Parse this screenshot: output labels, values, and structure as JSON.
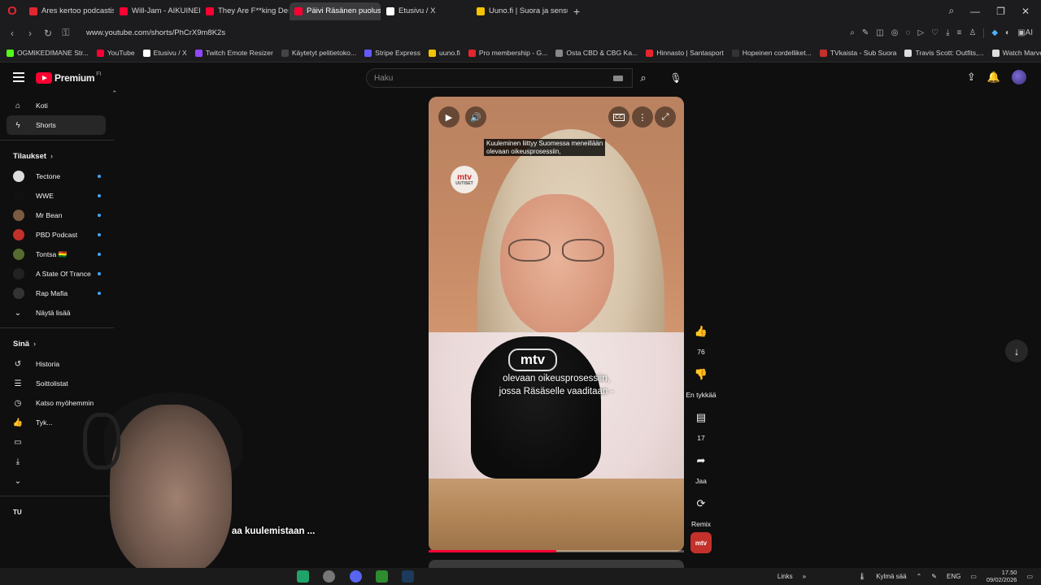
{
  "browser": {
    "tabs": [
      {
        "label": "Ares kertoo podcastissa v",
        "favicon_color": "#e3262f",
        "active": false
      },
      {
        "label": "Will-Jam - AIKUINEN - Yo",
        "favicon_color": "#ff0033",
        "active": false
      },
      {
        "label": "They Are F**king Desperat",
        "favicon_color": "#ff0033",
        "active": false
      },
      {
        "label": "Päivi Räsänen puolustaa k",
        "favicon_color": "#ff0033",
        "active": true
      },
      {
        "label": "Etusivu / X",
        "favicon_color": "#ffffff",
        "active": false
      },
      {
        "label": "Uuno.fi | Suora ja sensuroi",
        "favicon_color": "#f5c400",
        "active": false
      }
    ],
    "url": "www.youtube.com/shorts/PhCrX9m8K2s",
    "bookmarks": [
      {
        "label": "OGMIKEDIMANE Str...",
        "color": "#53fc18"
      },
      {
        "label": "YouTube",
        "color": "#ff0033"
      },
      {
        "label": "Etusivu / X",
        "color": "#ffffff"
      },
      {
        "label": "Twitch Emote Resizer",
        "color": "#9147ff"
      },
      {
        "label": "Käytetyt pelitietoko...",
        "color": "#444444"
      },
      {
        "label": "Stripe Express",
        "color": "#635bff"
      },
      {
        "label": "uuno.fi",
        "color": "#f5c400"
      },
      {
        "label": "Pro membership - G...",
        "color": "#e3262f"
      },
      {
        "label": "Osta CBD & CBG Ka...",
        "color": "#888888"
      },
      {
        "label": "Hinnasto | Santasport",
        "color": "#e3262f"
      },
      {
        "label": "Hopeinen cordelliket...",
        "color": "#333333"
      },
      {
        "label": "TVkaista - Sub Suora",
        "color": "#c4302b"
      },
      {
        "label": "Travis Scott: Outfits,...",
        "color": "#dddddd"
      },
      {
        "label": "Watch Marvel's Luk...",
        "color": "#dddddd"
      }
    ]
  },
  "youtube": {
    "logo_text": "Premium",
    "region": "FI",
    "search_placeholder": "Haku",
    "sidebar": {
      "main": [
        {
          "label": "Koti",
          "icon": "home-icon",
          "selected": false
        },
        {
          "label": "Shorts",
          "icon": "shorts-icon",
          "selected": true
        }
      ],
      "subscriptions_title": "Tilaukset",
      "subscriptions": [
        {
          "label": "Tectone",
          "color": "#dddddd"
        },
        {
          "label": "WWE",
          "color": "#111111"
        },
        {
          "label": "Mr Bean",
          "color": "#7a5a40"
        },
        {
          "label": "PBD Podcast",
          "color": "#c4302b"
        },
        {
          "label": "Tontsa 🇧🇴",
          "color": "#556b2f"
        },
        {
          "label": "A State Of Trance",
          "color": "#222222"
        },
        {
          "label": "Rap Mafia",
          "color": "#333333"
        }
      ],
      "show_more": "Näytä lisää",
      "you_title": "Sinä",
      "you_items": [
        {
          "label": "Historia",
          "icon": "history-icon"
        },
        {
          "label": "Soittolistat",
          "icon": "playlists-icon"
        },
        {
          "label": "Katso myöhemmin",
          "icon": "watch-later-icon"
        },
        {
          "label": "Tyk...",
          "icon": "like-icon"
        }
      ],
      "section_partial": "TU"
    },
    "video": {
      "top_subtitle": "Kuuleminen liittyy Suomessa meneillään\nolevaan oikeusprosessiin,",
      "mid_subtitle": "olevaan oikeusprosessiin,\njossa Räsäselle vaaditaan -",
      "channel_badge": "mtv",
      "channel_badge_sub": "UUTISET",
      "progress_fraction": 0.5
    },
    "actions": [
      {
        "icon": "like-icon",
        "label": "76"
      },
      {
        "icon": "dislike-icon",
        "label": "En tykkää"
      },
      {
        "icon": "comment-icon",
        "label": "17"
      },
      {
        "icon": "share-icon",
        "label": "Jaa"
      },
      {
        "icon": "remix-icon",
        "label": "Remix"
      }
    ]
  },
  "overlay": {
    "caption": "aa kuulemistaan ..."
  },
  "taskbar": {
    "links": "Links",
    "weather": "Kylmä sää",
    "lang": "ENG",
    "time": "17.50",
    "date": "09/02/2026"
  }
}
